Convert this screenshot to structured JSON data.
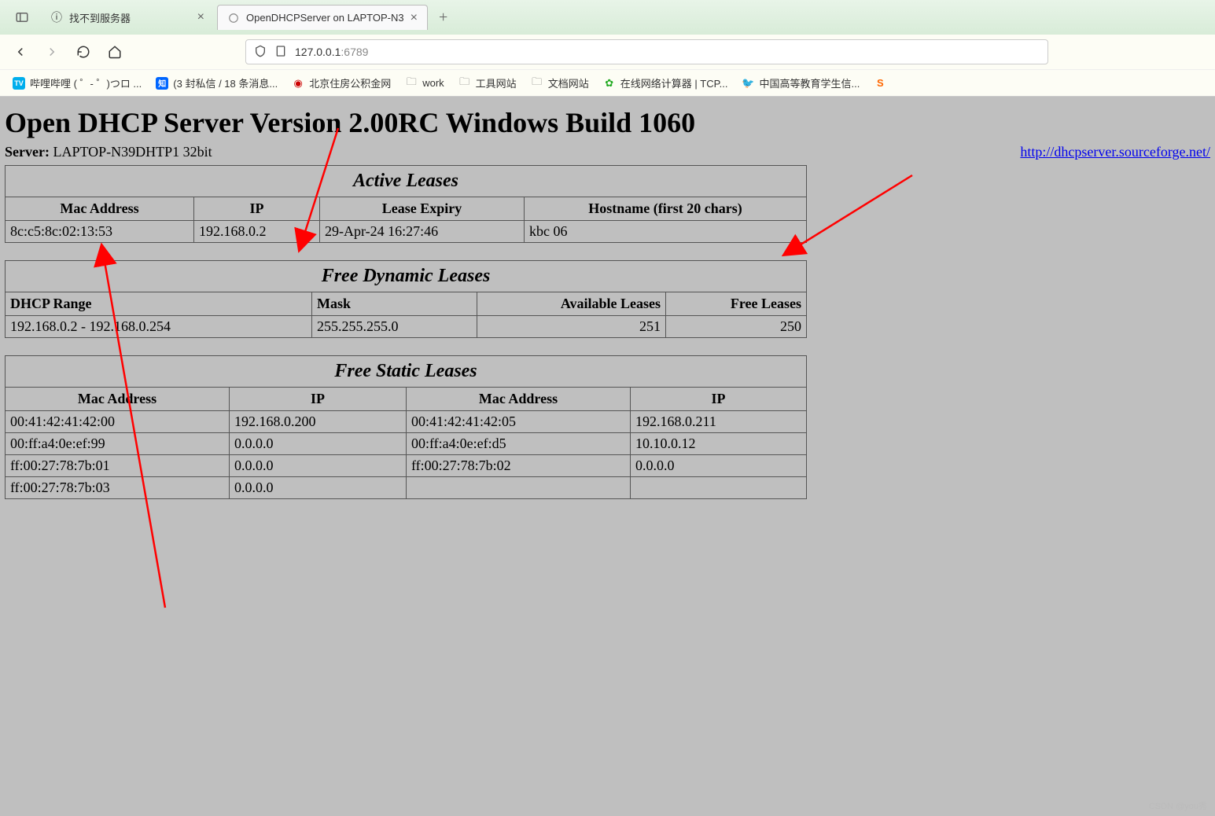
{
  "tabs": {
    "inactive": {
      "title": "找不到服务器",
      "favicon": "ⓘ"
    },
    "active": {
      "title": "OpenDHCPServer on LAPTOP-N3"
    }
  },
  "url": {
    "host": "127.0.0.1",
    "port": ":6789"
  },
  "bookmarks": [
    {
      "icon": "bili",
      "label": "哔哩哔哩 (  ゜-  ゜)つロ ..."
    },
    {
      "icon": "zhi",
      "label": "(3 封私信 / 18 条消息..."
    },
    {
      "icon": "red",
      "label": "北京住房公积金网"
    },
    {
      "icon": "folder",
      "label": "work"
    },
    {
      "icon": "folder",
      "label": "工具网站"
    },
    {
      "icon": "folder",
      "label": "文档网站"
    },
    {
      "icon": "green",
      "label": "在线网络计算器 | TCP..."
    },
    {
      "icon": "bird",
      "label": "中国高等教育学生信..."
    },
    {
      "icon": "s",
      "label": "S"
    }
  ],
  "page": {
    "h1": "Open DHCP Server Version 2.00RC Windows Build 1060",
    "server_label": "Server:",
    "server_name": "LAPTOP-N39DHTP1 32bit",
    "project_link": "http://dhcpserver.sourceforge.net/"
  },
  "active_leases": {
    "title": "Active Leases",
    "cols": [
      "Mac Address",
      "IP",
      "Lease Expiry",
      "Hostname (first 20 chars)"
    ],
    "rows": [
      {
        "mac": "8c:c5:8c:02:13:53",
        "ip": "192.168.0.2",
        "exp": "29-Apr-24 16:27:46",
        "host": "kbc         06"
      }
    ]
  },
  "free_dynamic": {
    "title": "Free Dynamic Leases",
    "cols": [
      "DHCP Range",
      "Mask",
      "Available Leases",
      "Free Leases"
    ],
    "rows": [
      {
        "range": "192.168.0.2 - 192.168.0.254",
        "mask": "255.255.255.0",
        "avail": "251",
        "free": "250"
      }
    ]
  },
  "free_static": {
    "title": "Free Static Leases",
    "cols": [
      "Mac Address",
      "IP",
      "Mac Address",
      "IP"
    ],
    "rows": [
      {
        "m1": "00:41:42:41:42:00",
        "i1": "192.168.0.200",
        "m2": "00:41:42:41:42:05",
        "i2": "192.168.0.211"
      },
      {
        "m1": "00:ff:a4:0e:ef:99",
        "i1": "0.0.0.0",
        "m2": "00:ff:a4:0e:ef:d5",
        "i2": "10.10.0.12"
      },
      {
        "m1": "ff:00:27:78:7b:01",
        "i1": "0.0.0.0",
        "m2": "ff:00:27:78:7b:02",
        "i2": "0.0.0.0"
      },
      {
        "m1": "ff:00:27:78:7b:03",
        "i1": "0.0.0.0",
        "m2": "",
        "i2": ""
      }
    ]
  },
  "watermark": "CSDN @you秀"
}
